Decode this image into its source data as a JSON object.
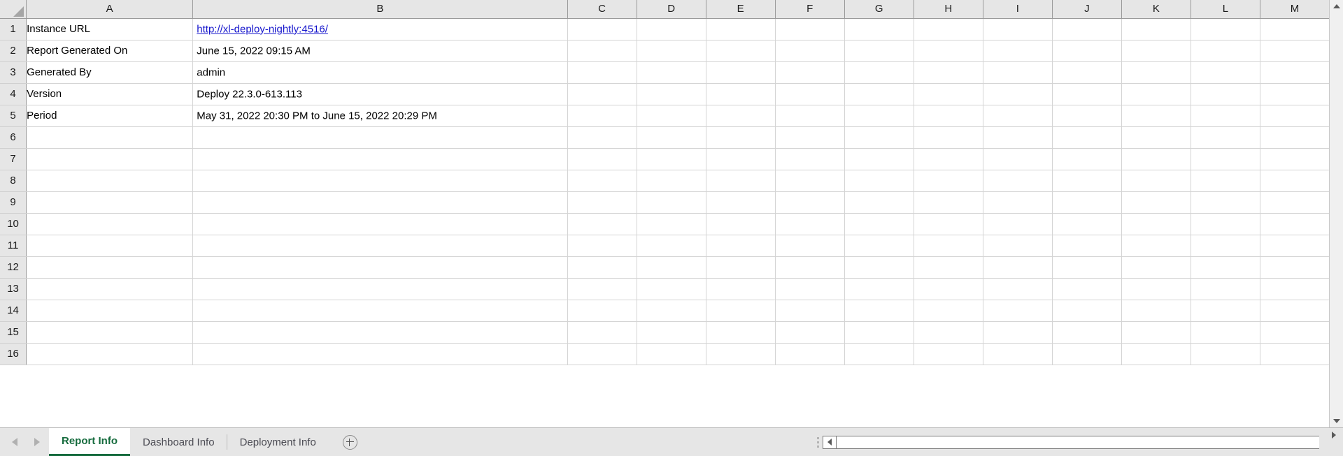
{
  "columns": [
    "A",
    "B",
    "C",
    "D",
    "E",
    "F",
    "G",
    "H",
    "I",
    "J",
    "K",
    "L",
    "M"
  ],
  "rows": [
    {
      "num": "1",
      "a": "Instance URL",
      "b": "http://xl-deploy-nightly:4516/",
      "b_is_link": true
    },
    {
      "num": "2",
      "a": "Report Generated On",
      "b": "June 15, 2022 09:15 AM",
      "b_is_link": false
    },
    {
      "num": "3",
      "a": "Generated By",
      "b": "admin",
      "b_is_link": false
    },
    {
      "num": "4",
      "a": "Version",
      "b": "Deploy 22.3.0-613.113",
      "b_is_link": false
    },
    {
      "num": "5",
      "a": "Period",
      "b": "May 31, 2022 20:30 PM to June 15, 2022 20:29 PM",
      "b_is_link": false
    },
    {
      "num": "6",
      "a": "",
      "b": "",
      "b_is_link": false
    },
    {
      "num": "7",
      "a": "",
      "b": "",
      "b_is_link": false
    },
    {
      "num": "8",
      "a": "",
      "b": "",
      "b_is_link": false
    },
    {
      "num": "9",
      "a": "",
      "b": "",
      "b_is_link": false
    },
    {
      "num": "10",
      "a": "",
      "b": "",
      "b_is_link": false
    },
    {
      "num": "11",
      "a": "",
      "b": "",
      "b_is_link": false
    },
    {
      "num": "12",
      "a": "",
      "b": "",
      "b_is_link": false
    },
    {
      "num": "13",
      "a": "",
      "b": "",
      "b_is_link": false
    },
    {
      "num": "14",
      "a": "",
      "b": "",
      "b_is_link": false
    },
    {
      "num": "15",
      "a": "",
      "b": "",
      "b_is_link": false
    },
    {
      "num": "16",
      "a": "",
      "b": "",
      "b_is_link": false
    }
  ],
  "sheet_tabs": [
    {
      "label": "Report Info",
      "active": true
    },
    {
      "label": "Dashboard Info",
      "active": false
    },
    {
      "label": "Deployment Info",
      "active": false
    }
  ],
  "icons": {
    "select_all": "select-all-triangle",
    "tab_prev": "previous-sheet-arrow",
    "tab_next": "next-sheet-arrow",
    "add_sheet": "add-sheet-plus-icon",
    "scroll_left": "scroll-left-arrow",
    "scroll_right": "scroll-right-arrow",
    "scroll_up": "scroll-up-arrow",
    "scroll_down": "scroll-down-arrow",
    "split_handle": "split-handle-dots"
  },
  "colors": {
    "active_tab_text": "#156b3d",
    "header_fill": "#e6e6e6",
    "link": "#1414cc",
    "grid_line": "#d4d4d4"
  }
}
